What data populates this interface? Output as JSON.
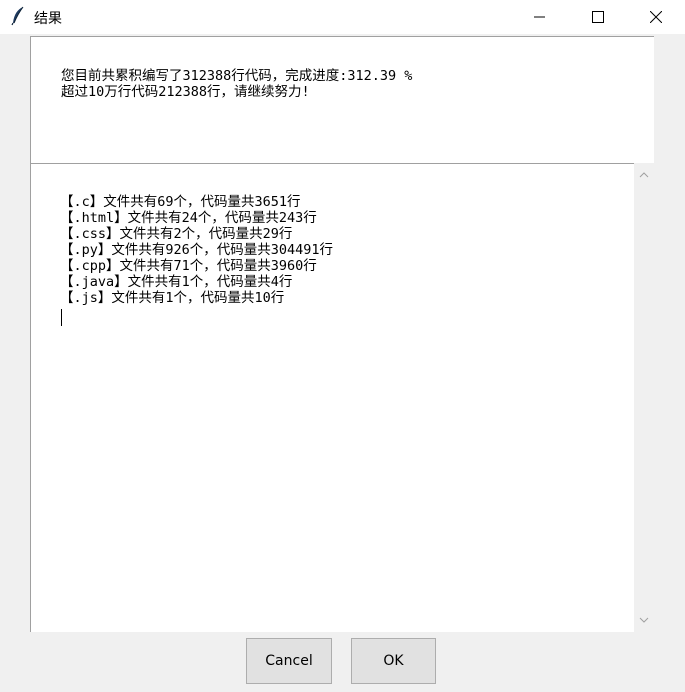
{
  "window": {
    "title": "结果"
  },
  "message": {
    "line1": "您目前共累积编写了312388行代码，完成进度:312.39 %",
    "line2": "超过10万行代码212388行，请继续努力!"
  },
  "files": [
    "【.c】文件共有69个，代码量共3651行",
    "【.html】文件共有24个，代码量共243行",
    "【.css】文件共有2个，代码量共29行",
    "【.py】文件共有926个，代码量共304491行",
    "【.cpp】文件共有71个，代码量共3960行",
    "【.java】文件共有1个，代码量共4行",
    "【.js】文件共有1个，代码量共10行"
  ],
  "buttons": {
    "cancel": "Cancel",
    "ok": "OK"
  },
  "icons": {
    "app": "feather-icon",
    "minimize": "minimize-icon",
    "maximize": "maximize-icon",
    "close": "close-icon"
  }
}
